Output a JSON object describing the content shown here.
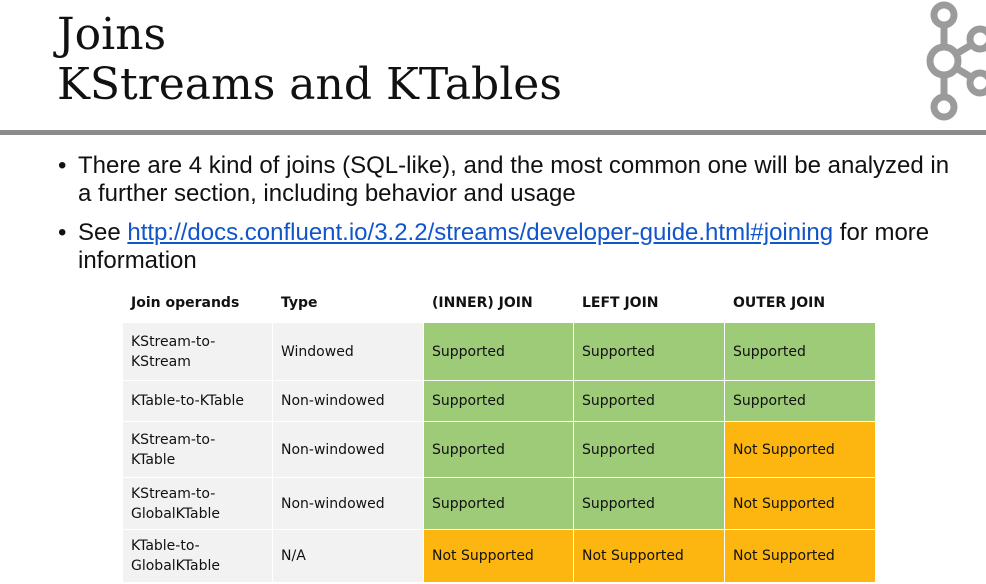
{
  "slide": {
    "title_line1": "Joins",
    "title_line2": "KStreams and KTables",
    "logo": "kafka-logo"
  },
  "bullets": {
    "item1": "There are 4 kind of joins (SQL-like), and the most common one will be analyzed in a further section, including behavior and usage",
    "item2_prefix": "See ",
    "item2_link": "http://docs.confluent.io/3.2.2/streams/developer-guide.html#joining",
    "item2_suffix": " for more information"
  },
  "table": {
    "headers": [
      "Join operands",
      "Type",
      "(INNER) JOIN",
      "LEFT JOIN",
      "OUTER JOIN"
    ],
    "rows": [
      {
        "operands": "KStream-to-KStream",
        "type": "Windowed",
        "inner": "Supported",
        "left": "Supported",
        "outer": "Supported"
      },
      {
        "operands": "KTable-to-KTable",
        "type": "Non-windowed",
        "inner": "Supported",
        "left": "Supported",
        "outer": "Supported"
      },
      {
        "operands": "KStream-to-KTable",
        "type": "Non-windowed",
        "inner": "Supported",
        "left": "Supported",
        "outer": "Not Supported"
      },
      {
        "operands": "KStream-to-GlobalKTable",
        "type": "Non-windowed",
        "inner": "Supported",
        "left": "Supported",
        "outer": "Not Supported"
      },
      {
        "operands": "KTable-to-GlobalKTable",
        "type": "N/A",
        "inner": "Not Supported",
        "left": "Not Supported",
        "outer": "Not Supported"
      }
    ]
  },
  "colors": {
    "supported": "#9dcb78",
    "not_supported": "#fdb60f",
    "row_bg": "#f2f2f2",
    "rule": "#8c8c8c",
    "link": "#1155cc"
  }
}
